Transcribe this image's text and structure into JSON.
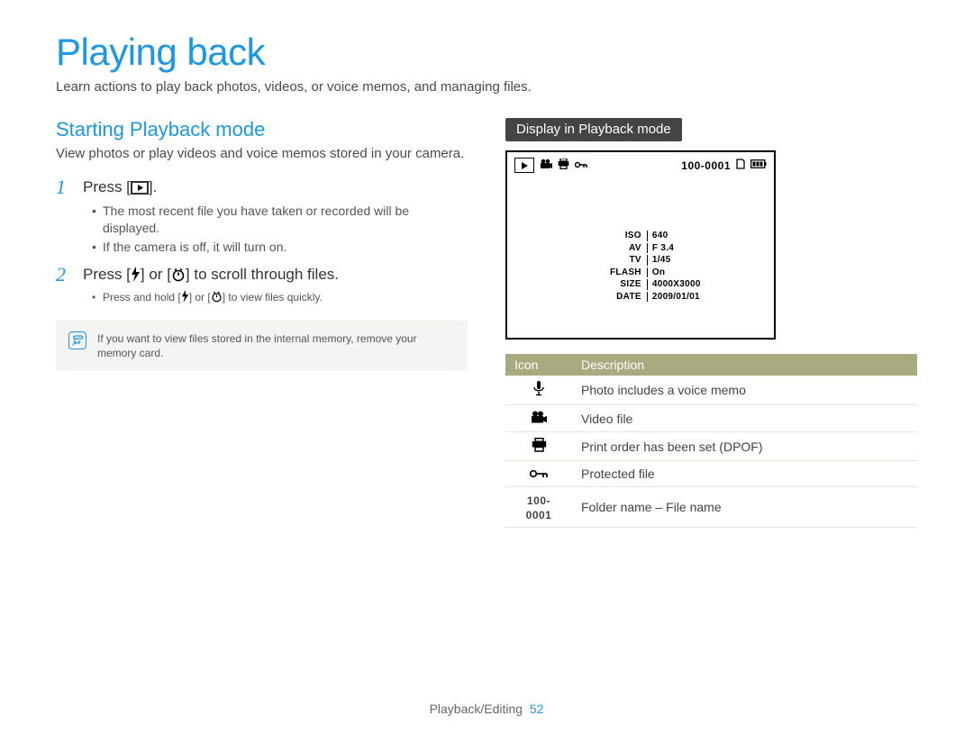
{
  "title": "Playing back",
  "subtitle": "Learn actions to play back photos, videos, or voice memos, and managing files.",
  "left": {
    "section_title": "Starting Playback mode",
    "intro": "View photos or play videos and voice memos stored in your camera.",
    "steps": [
      {
        "num": "1",
        "text_pre": "Press [",
        "text_post": "].",
        "bullets": [
          "The most recent file you have taken or recorded will be displayed.",
          "If the camera is off, it will turn on."
        ]
      },
      {
        "num": "2",
        "text_pre": "Press [",
        "text_mid": "] or [",
        "text_post": "] to scroll through files.",
        "sub_pre": "Press and hold [",
        "sub_mid": "] or [",
        "sub_post": "] to view files quickly."
      }
    ],
    "note": "If you want to view files stored in the internal memory, remove your memory card."
  },
  "right": {
    "pill": "Display in Playback mode",
    "lcd": {
      "file_label": "100-0001",
      "info": {
        "ISO": "640",
        "AV": "F 3.4",
        "TV": "1/45",
        "FLASH": "On",
        "SIZE": "4000X3000",
        "DATE": "2009/01/01"
      }
    },
    "table": {
      "head_icon": "Icon",
      "head_desc": "Description",
      "rows": [
        {
          "desc": "Photo includes a voice memo"
        },
        {
          "desc": "Video file"
        },
        {
          "desc": "Print order has been set (DPOF)"
        },
        {
          "desc": "Protected file"
        },
        {
          "label": "100-0001",
          "desc": "Folder name – File name"
        }
      ]
    }
  },
  "footer": {
    "section": "Playback/Editing",
    "page": "52"
  }
}
